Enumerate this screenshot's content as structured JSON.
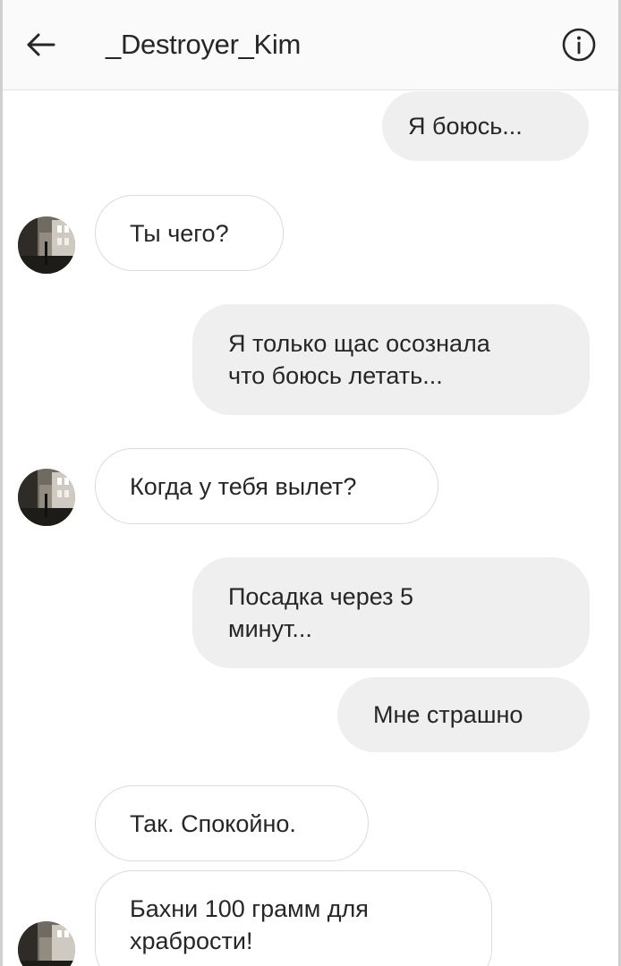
{
  "header": {
    "title": "_Destroyer_Kim",
    "back_icon": "arrow-left-icon",
    "info_icon": "info-circle-icon"
  },
  "colors": {
    "outgoing_bubble": "#efefef",
    "incoming_border": "#dbdbdb",
    "text": "#262626"
  },
  "messages": [
    {
      "direction": "out",
      "text": "Я боюсь..."
    },
    {
      "direction": "in",
      "text": "Ты чего?",
      "has_avatar": true
    },
    {
      "direction": "out",
      "text": "Я только щас осознала\nчто боюсь летать..."
    },
    {
      "direction": "in",
      "text": "Когда у тебя вылет?",
      "has_avatar": true
    },
    {
      "direction": "out",
      "text": "Посадка через 5\nминут..."
    },
    {
      "direction": "out",
      "text": "Мне страшно"
    },
    {
      "direction": "in",
      "text": "Так. Спокойно."
    },
    {
      "direction": "in",
      "text": "Бахни 100 грамм для\nхрабрости!",
      "has_avatar": true
    }
  ]
}
